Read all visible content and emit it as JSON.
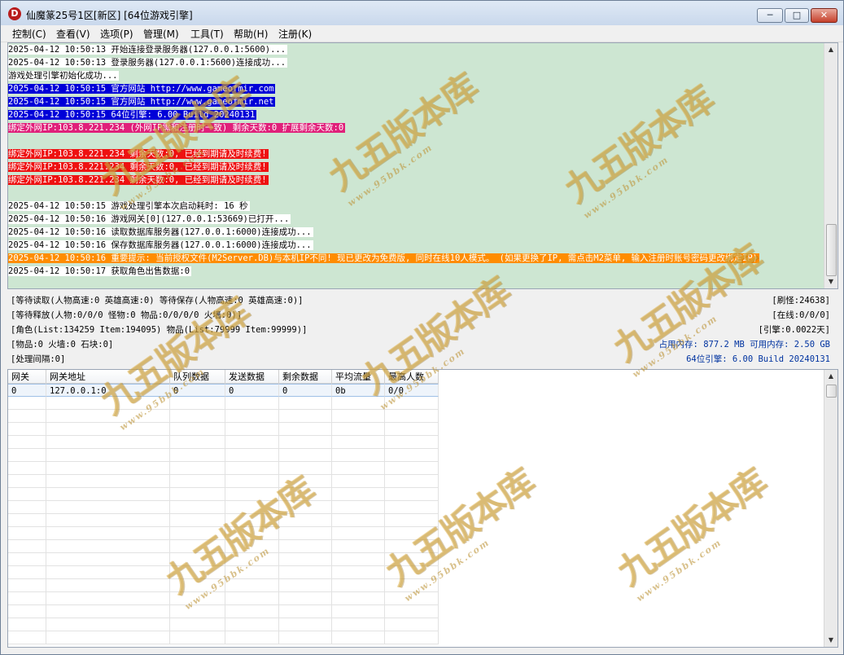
{
  "window": {
    "title": "仙魔篆25号1区[新区]  [64位游戏引擎]",
    "app_icon_letter": "D",
    "minimize": "─",
    "maximize": "□",
    "close": "✕"
  },
  "menu": [
    "控制(C)",
    "查看(V)",
    "选项(P)",
    "管理(M)",
    "工具(T)",
    "帮助(H)",
    "注册(K)"
  ],
  "log": [
    {
      "text": "2025-04-12 10:50:13 开始连接登录服务器(127.0.0.1:5600)...",
      "bg": "#ffffff",
      "fg": "#000000"
    },
    {
      "text": "2025-04-12 10:50:13 登录服务器(127.0.0.1:5600)连接成功...",
      "bg": "#ffffff",
      "fg": "#000000"
    },
    {
      "text": "游戏处理引擎初始化成功...",
      "bg": "#ffffff",
      "fg": "#000000"
    },
    {
      "text": "2025-04-12 10:50:15 官方网站 http://www.gameofmir.com",
      "bg": "#0000d8",
      "fg": "#ffffff"
    },
    {
      "text": "2025-04-12 10:50:15 官方网站 http://www.gameofmir.net",
      "bg": "#0000d8",
      "fg": "#ffffff"
    },
    {
      "text": "2025-04-12 10:50:15 64位引擎: 6.00 Build 20240131",
      "bg": "#0000d8",
      "fg": "#ffffff"
    },
    {
      "text": "绑定外网IP:103.8.221.234 (外网IP需和注册时一致) 剩余天数:0 扩展剩余天数:0",
      "bg": "#e0207a",
      "fg": "#ffffff"
    },
    {
      "text": "",
      "bg": "transparent",
      "fg": "#000000"
    },
    {
      "text": "绑定外网IP:103.8.221.234 剩余天数:0, 已经到期请及时续费!",
      "bg": "#ee1111",
      "fg": "#ffffff"
    },
    {
      "text": "绑定外网IP:103.8.221.234 剩余天数:0, 已经到期请及时续费!",
      "bg": "#ee1111",
      "fg": "#ffffff"
    },
    {
      "text": "绑定外网IP:103.8.221.234 剩余天数:0, 已经到期请及时续费!",
      "bg": "#ee1111",
      "fg": "#ffffff"
    },
    {
      "text": "",
      "bg": "transparent",
      "fg": "#000000"
    },
    {
      "text": "2025-04-12 10:50:15 游戏处理引擎本次启动耗时: 16 秒",
      "bg": "#ffffff",
      "fg": "#000000"
    },
    {
      "text": "2025-04-12 10:50:16 游戏网关[0](127.0.0.1:53669)已打开...",
      "bg": "#ffffff",
      "fg": "#000000"
    },
    {
      "text": "2025-04-12 10:50:16 读取数据库服务器(127.0.0.1:6000)连接成功...",
      "bg": "#ffffff",
      "fg": "#000000"
    },
    {
      "text": "2025-04-12 10:50:16 保存数据库服务器(127.0.0.1:6000)连接成功...",
      "bg": "#ffffff",
      "fg": "#000000"
    },
    {
      "text": "2025-04-12 10:50:16 重要提示: 当前授权文件(M2Server.DB)与本机IP不同! 现已更改为免费版, 同时在线10人模式。 (如果更换了IP, 需点击M2菜单, 输入注册时账号密码更改绑定IP)",
      "bg": "#ff8c00",
      "fg": "#ffffff"
    },
    {
      "text": "2025-04-12 10:50:17 获取角色出售数据:0",
      "bg": "#ffffff",
      "fg": "#000000"
    }
  ],
  "stats": {
    "wait_read": "[等待读取(人物高速:0 英雄高速:0) 等待保存(人物高速:0 英雄高速:0)]",
    "wait_release": "[等待释放(人物:0/0/0 怪物:0 物品:0/0/0/0 火墙:0)]",
    "role": "[角色(List:134259 Item:194095) 物品(List:79999 Item:99999)]",
    "items": "[物品:0 火墙:0 石块:0]",
    "interval": "[处理间隔:0]",
    "refresh_monster": "[刷怪:24638]",
    "online": "[在线:0/0/0]",
    "engine_time": "[引擎:0.0022天]",
    "memory": "占用内存: 877.2 MB 可用内存: 2.50 GB",
    "engine_version": "64位引擎: 6.00 Build 20240131"
  },
  "grid": {
    "columns": [
      "网关",
      "网关地址",
      "队列数据",
      "发送数据",
      "剩余数据",
      "平均流量",
      "最高人数"
    ],
    "rows": [
      [
        "0",
        "127.0.0.1:0",
        "0",
        "0",
        "0",
        "0b",
        "0/0"
      ]
    ]
  },
  "watermark": {
    "main": "九五版本库",
    "sub": "www.95bbk.com"
  }
}
